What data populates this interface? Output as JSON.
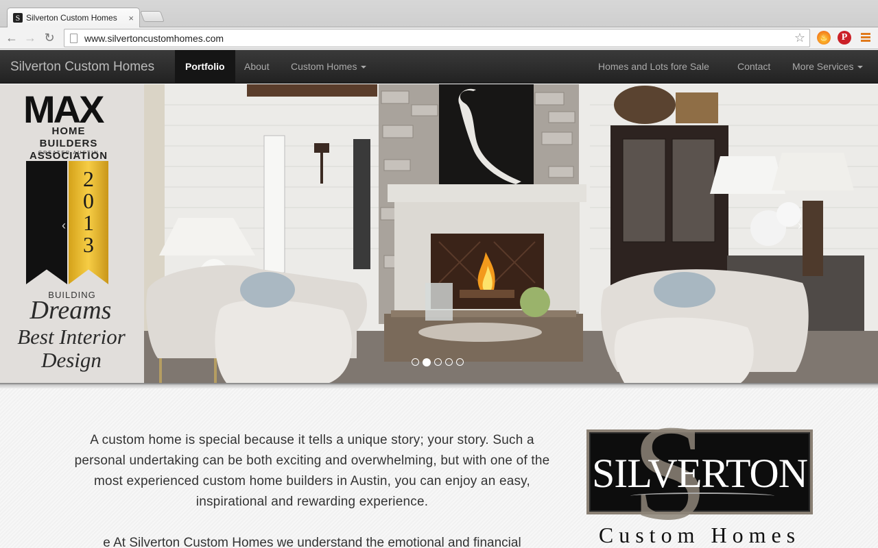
{
  "browser": {
    "tab_title": "Silverton Custom Homes",
    "tab_close": "×",
    "url": "www.silvertoncustomhomes.com",
    "icons": [
      "back-icon",
      "forward-icon",
      "reload-icon",
      "page-icon",
      "bookmark-star-icon",
      "fire-extension-icon",
      "pinterest-extension-icon",
      "menu-icon"
    ]
  },
  "navbar": {
    "brand": "Silverton Custom Homes",
    "left_items": [
      {
        "label": "Portfolio",
        "active": true
      },
      {
        "label": "About"
      },
      {
        "label": "Custom Homes",
        "dropdown": true
      }
    ],
    "right_items": [
      {
        "label": "Homes and Lots fore Sale"
      },
      {
        "label": "Contact"
      },
      {
        "label": "More Services",
        "dropdown": true
      }
    ]
  },
  "hero": {
    "award": {
      "logo": "MAX",
      "org_line1": "HOME BUILDERS",
      "org_line2": "ASSOCIATION",
      "org_line3": "GREATER AUSTIN",
      "year_digits": [
        "2",
        "0",
        "1",
        "3"
      ],
      "building": "BUILDING",
      "dreams": "Dreams",
      "award_name_line1": "Best Interior",
      "award_name_line2": "Design"
    },
    "prev_arrow": "‹",
    "next_arrow": "›",
    "slides_count": 5,
    "active_slide": 2
  },
  "content": {
    "intro": "A custom home is special because it tells a unique story; your story. Such a personal undertaking can be both exciting and overwhelming, but with one of the most experienced custom home builders in Austin, you can enjoy an easy, inspirational and rewarding experience.",
    "intro2": "e At Silverton Custom Homes we understand the emotional and financial",
    "logo_word": "SILVERTON",
    "logo_initial": "S",
    "logo_sub": "Custom Homes"
  },
  "colors": {
    "navbar_bg": "#2b2b2b",
    "active_nav_bg": "#151515",
    "award_gold": "#f2c434",
    "logo_frame": "#8a8074"
  }
}
